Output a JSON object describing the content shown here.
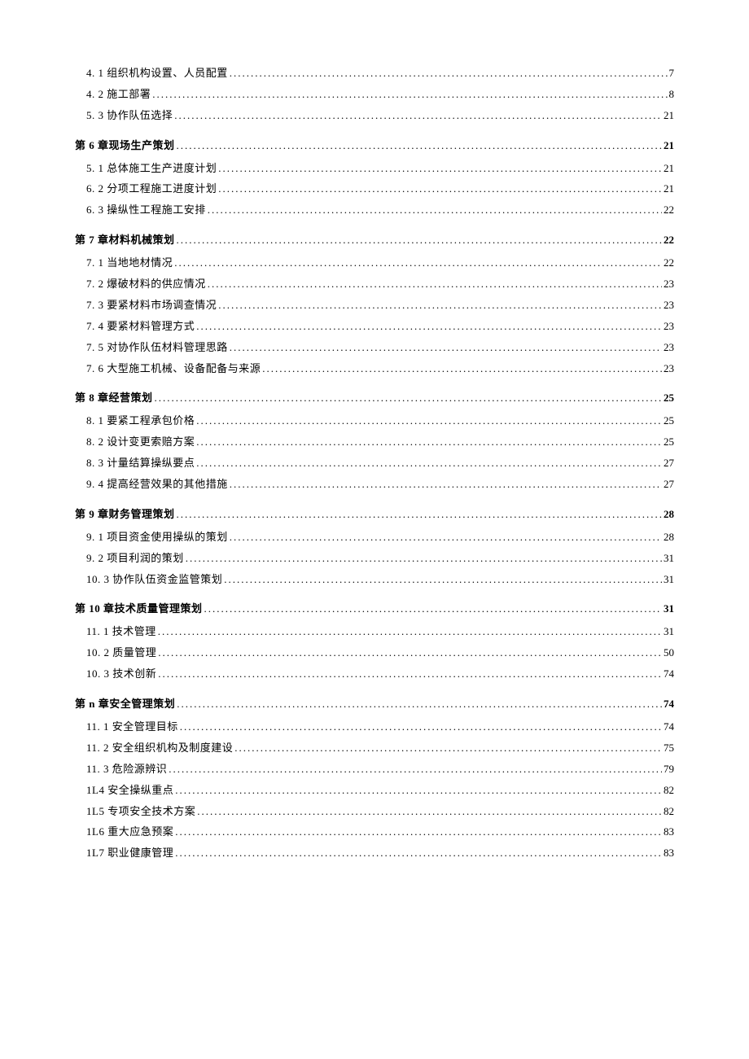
{
  "toc": [
    {
      "type": "sub",
      "label": "4. 1   组织机构设置、人员配置",
      "page": "7"
    },
    {
      "type": "sub",
      "label": "4. 2   施工部署 ",
      "page": "8"
    },
    {
      "type": "sub",
      "label": "5.   3 协作队伍选择 ",
      "page": "21"
    },
    {
      "type": "chapter",
      "label": "第 6 章现场生产策划",
      "page": "21"
    },
    {
      "type": "sub",
      "label": "5. 1   总体施工生产进度计划",
      "page": "21"
    },
    {
      "type": "sub",
      "label": "6.   2 分项工程施工进度计划 ",
      "page": "21"
    },
    {
      "type": "sub",
      "label": "6.   3 操纵性工程施工安排 ",
      "page": "22"
    },
    {
      "type": "chapter",
      "label": "第 7 章材料机械策划",
      "page": "22"
    },
    {
      "type": "sub",
      "label": "7. 1 当地地材情况 ",
      "page": "22"
    },
    {
      "type": "sub",
      "label": "7.   2 爆破材料的供应情况",
      "page": "23"
    },
    {
      "type": "sub",
      "label": "7.   3 要紧材料市场调查情况",
      "page": "23"
    },
    {
      "type": "sub",
      "label": "7. 4 要紧材料管理方式 ",
      "page": "23"
    },
    {
      "type": "sub",
      "label": "7. 5 对协作队伍材料管理思路 ",
      "page": "23"
    },
    {
      "type": "sub",
      "label": "7. 6 大型施工机械、设备配备与来源 ",
      "page": "23"
    },
    {
      "type": "chapter",
      "label": "第 8 章经营策划",
      "page": "25"
    },
    {
      "type": "sub",
      "label": "8. 1 要紧工程承包价格 ",
      "page": "25"
    },
    {
      "type": "sub",
      "label": "8. 2 设计变更索赔方案 ",
      "page": "25"
    },
    {
      "type": "sub",
      "label": "8.   3 计量结算操纵要点 ",
      "page": "27"
    },
    {
      "type": "sub",
      "label": "9.   4 提高经营效果的其他措施 ",
      "page": "27"
    },
    {
      "type": "chapter",
      "label": "第 9 章财务管理策划",
      "page": "28"
    },
    {
      "type": "sub",
      "label": "9. 1   项目资金使用操纵的策划 ",
      "page": "28"
    },
    {
      "type": "sub",
      "label": "9. 2   项目利润的策划 ",
      "page": "31"
    },
    {
      "type": "sub",
      "label": "10. 3 协作队伍资金监管策划 ",
      "page": "31"
    },
    {
      "type": "chapter",
      "label": "第 10 章技术质量管理策划",
      "page": "31"
    },
    {
      "type": "sub",
      "label": "11.   1 技术管理",
      "page": "31"
    },
    {
      "type": "sub",
      "label": "10. 2 质量管理 ",
      "page": "50"
    },
    {
      "type": "sub",
      "label": "10. 3 技术创新 ",
      "page": "74"
    },
    {
      "type": "chapter",
      "label": "第 n 章安全管理策划 ",
      "page": "74"
    },
    {
      "type": "sub",
      "label": "11. 1 安全管理目标",
      "page": "74"
    },
    {
      "type": "sub",
      "label": "11. 2 安全组织机构及制度建设 ",
      "page": "75"
    },
    {
      "type": "sub",
      "label": "11. 3 危险源辨识 ",
      "page": "79"
    },
    {
      "type": "sub",
      "label": "1L4 安全操纵重点 ",
      "page": "82"
    },
    {
      "type": "sub",
      "label": "1L5 专项安全技术方案 ",
      "page": "82"
    },
    {
      "type": "sub",
      "label": "1L6 重大应急预案",
      "page": "83"
    },
    {
      "type": "sub",
      "label": "1L7 职业健康管理 ",
      "page": "83"
    }
  ]
}
